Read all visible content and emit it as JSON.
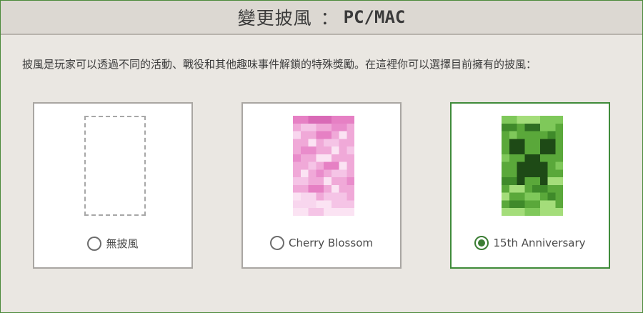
{
  "header": {
    "title": "變更披風",
    "separator": "：",
    "platform": "PC/MAC"
  },
  "intro": "披風是玩家可以透過不同的活動、戰役和其他趣味事件解鎖的特殊獎勵。在這裡你可以選擇目前擁有的披風：",
  "capes": [
    {
      "label": "無披風",
      "selected": false,
      "icon": "empty-cape-placeholder"
    },
    {
      "label": "Cherry Blossom",
      "selected": false,
      "icon": "cherry-blossom-cape",
      "color": "#ee8fd0"
    },
    {
      "label": "15th Anniversary",
      "selected": true,
      "icon": "creeper-cape",
      "color": "#5aa83a"
    }
  ],
  "colors": {
    "accent": "#3f8b3a",
    "card_border": "#a9a6a2"
  }
}
